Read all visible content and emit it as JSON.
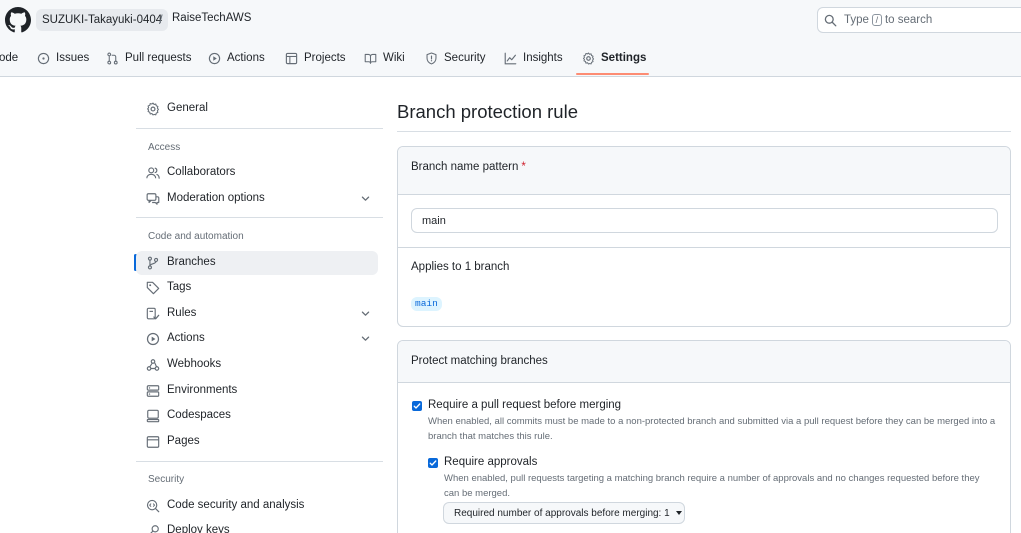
{
  "header": {
    "owner": "SUZUKI-Takayuki-0404",
    "separator": "/",
    "repo": "RaiseTechAWS",
    "search_prefix": "Type",
    "search_key": "/",
    "search_suffix": "to search"
  },
  "tabs": [
    {
      "label": "ode",
      "icon": "code-icon"
    },
    {
      "label": "Issues",
      "icon": "issue-icon"
    },
    {
      "label": "Pull requests",
      "icon": "pull-request-icon"
    },
    {
      "label": "Actions",
      "icon": "play-icon"
    },
    {
      "label": "Projects",
      "icon": "table-icon"
    },
    {
      "label": "Wiki",
      "icon": "book-icon"
    },
    {
      "label": "Security",
      "icon": "shield-icon"
    },
    {
      "label": "Insights",
      "icon": "graph-icon"
    },
    {
      "label": "Settings",
      "icon": "gear-icon"
    }
  ],
  "sidebar": {
    "general": "General",
    "access_heading": "Access",
    "collaborators": "Collaborators",
    "moderation": "Moderation options",
    "code_heading": "Code and automation",
    "branches": "Branches",
    "tags": "Tags",
    "rules": "Rules",
    "actions": "Actions",
    "webhooks": "Webhooks",
    "environments": "Environments",
    "codespaces": "Codespaces",
    "pages": "Pages",
    "security_heading": "Security",
    "code_security": "Code security and analysis",
    "deploy_keys": "Deploy keys"
  },
  "main": {
    "title": "Branch protection rule",
    "pattern_label": "Branch name pattern",
    "required_mark": "*",
    "pattern_value": "main",
    "applies_text": "Applies to 1 branch",
    "branch_chip": "main",
    "protect_heading": "Protect matching branches",
    "require_pr_title": "Require a pull request before merging",
    "require_pr_desc": "When enabled, all commits must be made to a non-protected branch and submitted via a pull request before they can be merged into a branch that matches this rule.",
    "require_approvals_title": "Require approvals",
    "require_approvals_desc": "When enabled, pull requests targeting a matching branch require a number of approvals and no changes requested before they can be merged.",
    "approvals_button": "Required number of approvals before merging: 1"
  },
  "colors": {
    "accent": "#0969da",
    "tab_underline": "#fd8c73",
    "required": "#cf222e"
  }
}
